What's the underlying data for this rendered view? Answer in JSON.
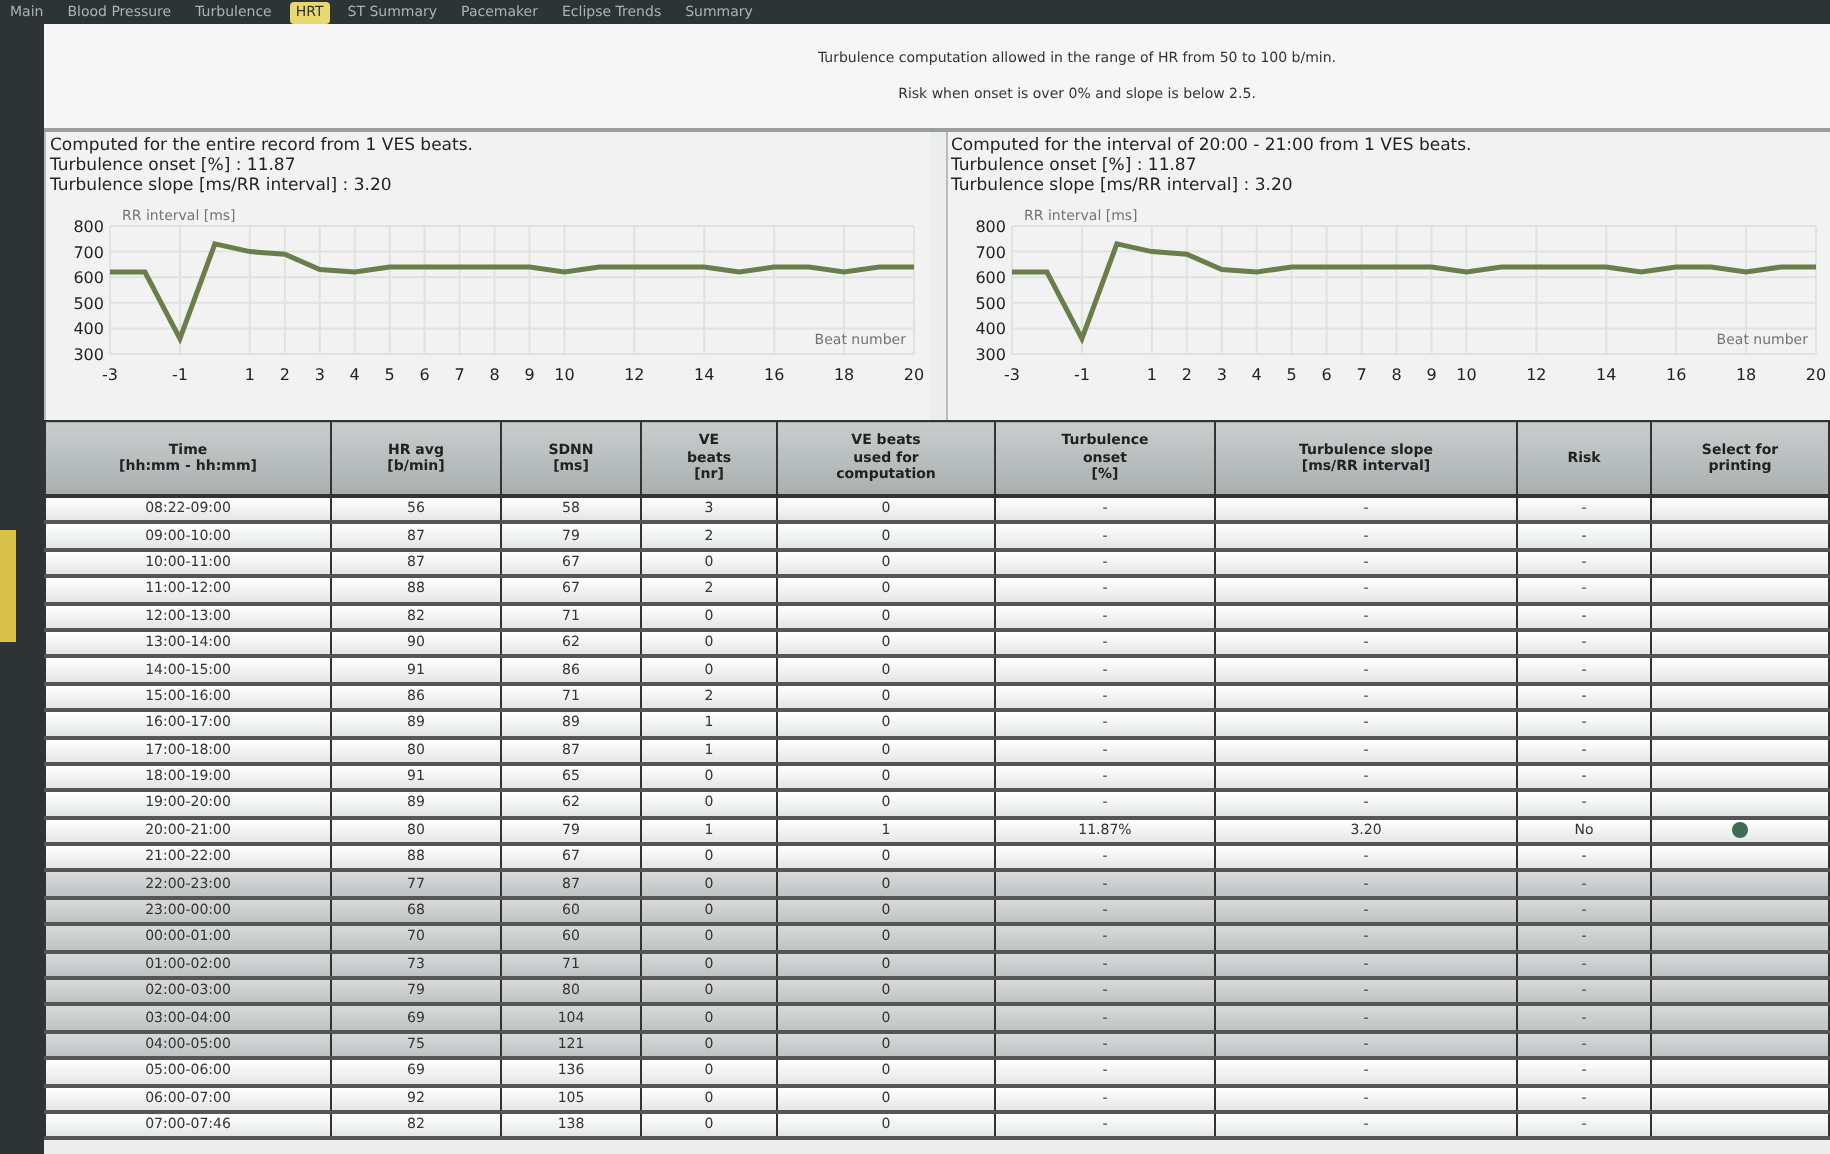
{
  "tabs": [
    {
      "label": "Main",
      "selected": false
    },
    {
      "label": "Blood Pressure",
      "selected": false
    },
    {
      "label": "Turbulence",
      "selected": false
    },
    {
      "label": "HRT",
      "selected": true
    },
    {
      "label": "ST Summary",
      "selected": false
    },
    {
      "label": "Pacemaker",
      "selected": false
    },
    {
      "label": "Eclipse Trends",
      "selected": false
    },
    {
      "label": "Summary",
      "selected": false
    }
  ],
  "notes": [
    "Turbulence computation allowed in the range of HR from 50 to 100 b/min.",
    "Risk when onset is over 0% and slope is below 2.5."
  ],
  "panels": [
    {
      "lines": [
        "Computed for the entire record from 1 VES beats.",
        "Turbulence onset [%] : 11.87",
        "Turbulence slope [ms/RR interval] : 3.20"
      ],
      "chart_data": {
        "type": "line",
        "ylabel": "RR interval [ms]",
        "xlabel": "Beat number",
        "grid": true,
        "x": [
          -3,
          -2,
          -1,
          0,
          1,
          2,
          3,
          4,
          5,
          6,
          7,
          8,
          9,
          10,
          11,
          12,
          13,
          14,
          15,
          16,
          17,
          18,
          19,
          20
        ],
        "series": [
          {
            "color": "#6b7d4a",
            "values": [
              620,
              620,
              360,
              730,
              700,
              690,
              630,
              620,
              640,
              640,
              640,
              640,
              640,
              620,
              640,
              640,
              640,
              640,
              620,
              640,
              640,
              620,
              640,
              640
            ]
          }
        ],
        "xlim": [
          -3,
          20
        ],
        "ylim": [
          300,
          800
        ],
        "xticks": [
          -3,
          -1,
          1,
          2,
          3,
          4,
          5,
          6,
          7,
          8,
          9,
          10,
          12,
          14,
          16,
          18,
          20
        ],
        "yticks": [
          300,
          400,
          500,
          600,
          700,
          800
        ]
      }
    },
    {
      "lines": [
        "Computed for the interval of 20:00 - 21:00 from 1 VES beats.",
        "Turbulence onset [%] : 11.87",
        "Turbulence slope [ms/RR interval] : 3.20"
      ],
      "chart_data": {
        "type": "line",
        "ylabel": "RR interval [ms]",
        "xlabel": "Beat number",
        "grid": true,
        "x": [
          -3,
          -2,
          -1,
          0,
          1,
          2,
          3,
          4,
          5,
          6,
          7,
          8,
          9,
          10,
          11,
          12,
          13,
          14,
          15,
          16,
          17,
          18,
          19,
          20
        ],
        "series": [
          {
            "color": "#6b7d4a",
            "values": [
              620,
              620,
              360,
              730,
              700,
              690,
              630,
              620,
              640,
              640,
              640,
              640,
              640,
              620,
              640,
              640,
              640,
              640,
              620,
              640,
              640,
              620,
              640,
              640
            ]
          }
        ],
        "xlim": [
          -3,
          20
        ],
        "ylim": [
          300,
          800
        ],
        "xticks": [
          -3,
          -1,
          1,
          2,
          3,
          4,
          5,
          6,
          7,
          8,
          9,
          10,
          12,
          14,
          16,
          18,
          20
        ],
        "yticks": [
          300,
          400,
          500,
          600,
          700,
          800
        ]
      }
    }
  ],
  "table": {
    "columns": [
      "Time\n[hh:mm - hh:mm]",
      "HR avg\n[b/min]",
      "SDNN\n[ms]",
      "VE\nbeats\n[nr]",
      "VE beats\nused for\ncomputation",
      "Turbulence\nonset\n[%]",
      "Turbulence slope\n[ms/RR interval]",
      "Risk",
      "Select for\nprinting"
    ],
    "rows": [
      {
        "cells": [
          "08:22-09:00",
          "56",
          "58",
          "3",
          "0",
          "-",
          "-",
          "-"
        ],
        "night": false,
        "selected_for_printing": false
      },
      {
        "cells": [
          "09:00-10:00",
          "87",
          "79",
          "2",
          "0",
          "-",
          "-",
          "-"
        ],
        "night": false,
        "selected_for_printing": false
      },
      {
        "cells": [
          "10:00-11:00",
          "87",
          "67",
          "0",
          "0",
          "-",
          "-",
          "-"
        ],
        "night": false,
        "selected_for_printing": false
      },
      {
        "cells": [
          "11:00-12:00",
          "88",
          "67",
          "2",
          "0",
          "-",
          "-",
          "-"
        ],
        "night": false,
        "selected_for_printing": false
      },
      {
        "cells": [
          "12:00-13:00",
          "82",
          "71",
          "0",
          "0",
          "-",
          "-",
          "-"
        ],
        "night": false,
        "selected_for_printing": false
      },
      {
        "cells": [
          "13:00-14:00",
          "90",
          "62",
          "0",
          "0",
          "-",
          "-",
          "-"
        ],
        "night": false,
        "selected_for_printing": false
      },
      {
        "cells": [
          "14:00-15:00",
          "91",
          "86",
          "0",
          "0",
          "-",
          "-",
          "-"
        ],
        "night": false,
        "selected_for_printing": false
      },
      {
        "cells": [
          "15:00-16:00",
          "86",
          "71",
          "2",
          "0",
          "-",
          "-",
          "-"
        ],
        "night": false,
        "selected_for_printing": false
      },
      {
        "cells": [
          "16:00-17:00",
          "89",
          "89",
          "1",
          "0",
          "-",
          "-",
          "-"
        ],
        "night": false,
        "selected_for_printing": false
      },
      {
        "cells": [
          "17:00-18:00",
          "80",
          "87",
          "1",
          "0",
          "-",
          "-",
          "-"
        ],
        "night": false,
        "selected_for_printing": false
      },
      {
        "cells": [
          "18:00-19:00",
          "91",
          "65",
          "0",
          "0",
          "-",
          "-",
          "-"
        ],
        "night": false,
        "selected_for_printing": false
      },
      {
        "cells": [
          "19:00-20:00",
          "89",
          "62",
          "0",
          "0",
          "-",
          "-",
          "-"
        ],
        "night": false,
        "selected_for_printing": false
      },
      {
        "cells": [
          "20:00-21:00",
          "80",
          "79",
          "1",
          "1",
          "11.87%",
          "3.20",
          "No"
        ],
        "night": false,
        "selected_for_printing": true
      },
      {
        "cells": [
          "21:00-22:00",
          "88",
          "67",
          "0",
          "0",
          "-",
          "-",
          "-"
        ],
        "night": false,
        "selected_for_printing": false
      },
      {
        "cells": [
          "22:00-23:00",
          "77",
          "87",
          "0",
          "0",
          "-",
          "-",
          "-"
        ],
        "night": true,
        "selected_for_printing": false
      },
      {
        "cells": [
          "23:00-00:00",
          "68",
          "60",
          "0",
          "0",
          "-",
          "-",
          "-"
        ],
        "night": true,
        "selected_for_printing": false
      },
      {
        "cells": [
          "00:00-01:00",
          "70",
          "60",
          "0",
          "0",
          "-",
          "-",
          "-"
        ],
        "night": true,
        "selected_for_printing": false
      },
      {
        "cells": [
          "01:00-02:00",
          "73",
          "71",
          "0",
          "0",
          "-",
          "-",
          "-"
        ],
        "night": true,
        "selected_for_printing": false
      },
      {
        "cells": [
          "02:00-03:00",
          "79",
          "80",
          "0",
          "0",
          "-",
          "-",
          "-"
        ],
        "night": true,
        "selected_for_printing": false
      },
      {
        "cells": [
          "03:00-04:00",
          "69",
          "104",
          "0",
          "0",
          "-",
          "-",
          "-"
        ],
        "night": true,
        "selected_for_printing": false
      },
      {
        "cells": [
          "04:00-05:00",
          "75",
          "121",
          "0",
          "0",
          "-",
          "-",
          "-"
        ],
        "night": true,
        "selected_for_printing": false
      },
      {
        "cells": [
          "05:00-06:00",
          "69",
          "136",
          "0",
          "0",
          "-",
          "-",
          "-"
        ],
        "night": false,
        "selected_for_printing": false
      },
      {
        "cells": [
          "06:00-07:00",
          "92",
          "105",
          "0",
          "0",
          "-",
          "-",
          "-"
        ],
        "night": false,
        "selected_for_printing": false
      },
      {
        "cells": [
          "07:00-07:46",
          "82",
          "138",
          "0",
          "0",
          "-",
          "-",
          "-"
        ],
        "night": false,
        "selected_for_printing": false
      }
    ]
  }
}
